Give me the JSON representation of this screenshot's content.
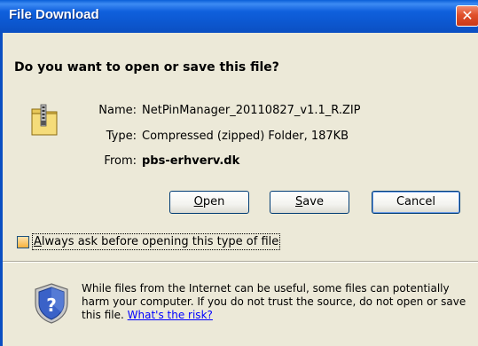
{
  "window": {
    "title": "File Download",
    "close_symbol": "✕",
    "accent_color": "#0b57d0",
    "close_color": "#e0502a"
  },
  "dialog": {
    "question": "Do you want to open or save this file?",
    "file_icon": "zip-folder-icon",
    "fields": {
      "name_label": "Name:",
      "name_value": "NetPinManager_20110827_v1.1_R.ZIP",
      "type_label": "Type:",
      "type_value": "Compressed (zipped) Folder, 187KB",
      "from_label": "From:",
      "from_value": "pbs-erhverv.dk"
    },
    "buttons": {
      "open_prefix": "",
      "open_mnemonic": "O",
      "open_rest": "pen",
      "save_prefix": "",
      "save_mnemonic": "S",
      "save_rest": "ave",
      "cancel_label": "Cancel"
    },
    "checkbox": {
      "mnemonic": "A",
      "rest": "lways ask before opening this type of file",
      "checked": false
    },
    "warning": {
      "icon": "shield-question-icon",
      "text": "While files from the Internet can be useful, some files can potentially harm your computer. If you do not trust the source, do not open or save this file.",
      "link": "What's the risk?"
    }
  }
}
